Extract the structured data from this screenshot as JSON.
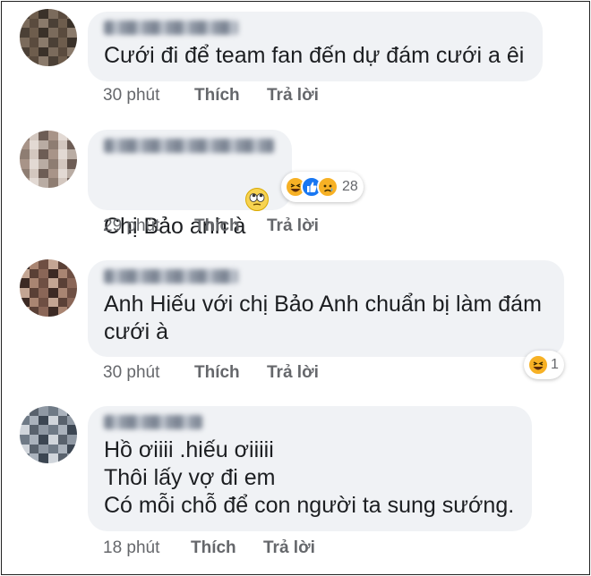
{
  "comments": [
    {
      "text": "Cưới đi để team fan đến dự đám cưới a êi",
      "time": "30 phút",
      "like_label": "Thích",
      "reply_label": "Trả lời",
      "avatar_colors": [
        "#4b4036",
        "#6e5d4d",
        "#3a3129",
        "#7b6b5c",
        "#5a4b3e",
        "#8a7a6b"
      ]
    },
    {
      "text": "Chị Bảo anh à",
      "inline_emoji": "eye-roll-emoji-icon",
      "time": "29 phút",
      "like_label": "Thích",
      "reply_label": "Trả lời",
      "reactions": {
        "icons": [
          "haha-reaction-icon",
          "like-reaction-icon",
          "sad-reaction-icon"
        ],
        "count": "28"
      },
      "avatar_colors": [
        "#b9aca3",
        "#8e7d72",
        "#d3c7bf",
        "#6d5d55",
        "#a89488",
        "#e2d9d3"
      ]
    },
    {
      "text": "Anh Hiếu với chị Bảo Anh chuẩn bị làm đám\ncưới à",
      "time": "30 phút",
      "like_label": "Thích",
      "reply_label": "Trả lời",
      "reactions": {
        "icons": [
          "haha-reaction-icon"
        ],
        "count": "1"
      },
      "avatar_colors": [
        "#5a4036",
        "#8a6657",
        "#3c2a24",
        "#a98572",
        "#6e4f43",
        "#c3a593"
      ]
    },
    {
      "text": "Hồ ơiiii .hiếu ơiiiii\nThôi lấy vợ đi em\nCó mỗi chỗ để con người ta sung sướng.",
      "time": "18 phút",
      "like_label": "Thích",
      "reply_label": "Trả lời",
      "avatar_colors": [
        "#6f7a86",
        "#aab2bc",
        "#3c4652",
        "#d0d5db",
        "#59626d",
        "#8f98a3"
      ]
    }
  ]
}
